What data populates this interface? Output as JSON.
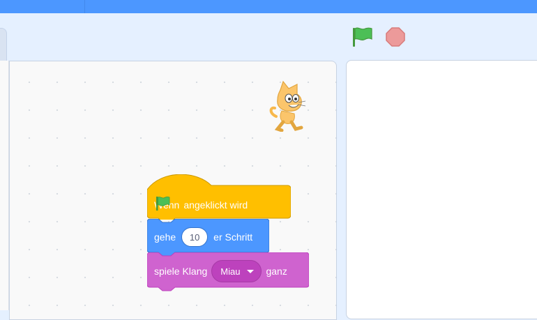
{
  "controls": {
    "green_flag_icon": "green-flag-icon",
    "stop_icon": "stop-sign-icon"
  },
  "workspace": {
    "sprite_thumbnail": "cat-sprite"
  },
  "script": {
    "hat_block": {
      "prefix": "Wenn",
      "flag_icon": "green-flag-icon",
      "suffix": "angeklickt wird"
    },
    "motion_block": {
      "prefix": "gehe",
      "steps_value": "10",
      "suffix": "er Schritt"
    },
    "sound_block": {
      "prefix": "spiele Klang",
      "sound_name": "Miau",
      "suffix": "ganz"
    }
  },
  "colors": {
    "menubar": "#4c97ff",
    "events": "#ffbf00",
    "motion": "#4c97ff",
    "sound": "#cf63cf",
    "flag": "#4cbf56",
    "stop": "#ec5959"
  }
}
